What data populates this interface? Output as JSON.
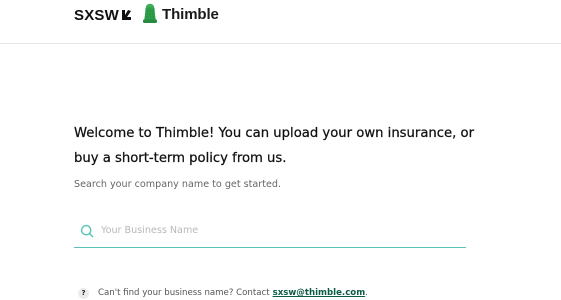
{
  "header": {
    "sxsw_logo_text": "SXSW",
    "thimble_logo_text": "Thimble"
  },
  "main": {
    "heading": "Welcome to Thimble! You can upload your own insurance, or buy a short-term policy from us.",
    "subtext": "Search your company name to get started.",
    "search": {
      "placeholder": "Your Business Name",
      "value": "",
      "icon": "search-icon"
    },
    "help": {
      "badge": "?",
      "text": "Can't find your business name? Contact",
      "link_text": "sxsw@thimble.com",
      "trailing": "."
    }
  },
  "colors": {
    "accent_teal": "#58c5b8",
    "link_green": "#0d5a47",
    "thimble_green": "#2f9e4b"
  }
}
